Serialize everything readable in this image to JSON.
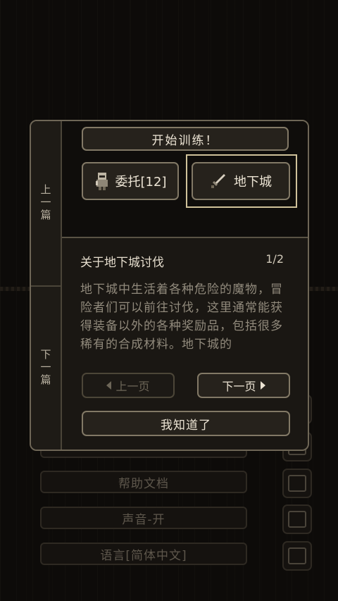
{
  "background_menu": {
    "items": [
      "帮助文档",
      "声音-开",
      "语言[简体中文]"
    ]
  },
  "tabs": {
    "prev_chars": [
      "上",
      "一",
      "篇"
    ],
    "next_chars": [
      "下",
      "一",
      "篇"
    ]
  },
  "actions": {
    "train_label": "开始训练！",
    "quest_label": "委托[12]",
    "dungeon_label": "地下城"
  },
  "info": {
    "title": "关于地下城讨伐",
    "page": "1/2",
    "body": "地下城中生活着各种危险的魔物，冒险者们可以前往讨伐，这里通常能获得装备以外的各种奖励品，包括很多稀有的合成材料。地下城的"
  },
  "pager": {
    "prev_label": "上一页",
    "next_label": "下一页",
    "ok_label": "我知道了"
  },
  "icons": [
    "quest-helmet-icon",
    "sword-icon",
    "arrow-left-icon",
    "arrow-right-icon"
  ],
  "colors": {
    "accent_border": "#cfc19a",
    "panel": "#1a1713",
    "text": "#ece4d4"
  }
}
